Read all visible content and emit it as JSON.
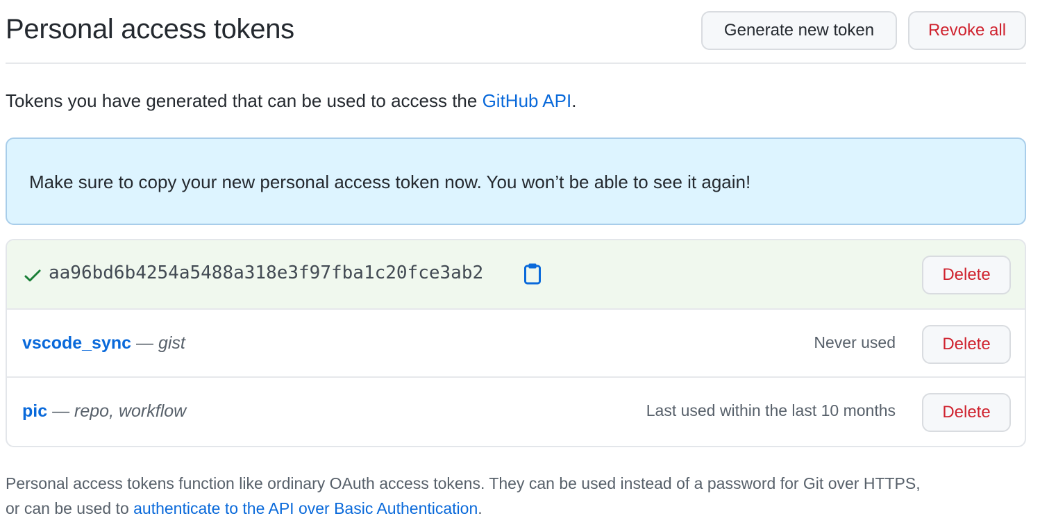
{
  "header": {
    "title": "Personal access tokens",
    "generate_label": "Generate new token",
    "revoke_label": "Revoke all"
  },
  "intro": {
    "text": "Tokens you have generated that can be used to access the ",
    "link": "GitHub API",
    "suffix": "."
  },
  "flash": {
    "message": "Make sure to copy your new personal access token now. You won’t be able to see it again!"
  },
  "new_token": {
    "value": "aa96bd6b4254a5488a318e3f97fba1c20fce3ab2",
    "delete_label": "Delete",
    "check_color": "#1a7f37",
    "copy_icon": "clipboard-icon"
  },
  "tokens": [
    {
      "name": "vscode_sync",
      "separator": " — ",
      "scopes": "gist",
      "last_used": "Never used",
      "delete_label": "Delete"
    },
    {
      "name": "pic",
      "separator": " — ",
      "scopes": "repo, workflow",
      "last_used": "Last used within the last 10 months",
      "delete_label": "Delete"
    }
  ],
  "footnote": {
    "line1": "Personal access tokens function like ordinary OAuth access tokens. They can be used instead of a password for Git over HTTPS,",
    "line2_prefix": "or can be used to ",
    "line2_link": "authenticate to the API over Basic Authentication",
    "line2_suffix": "."
  },
  "colors": {
    "link": "#0969da",
    "danger": "#cf222e",
    "flash_bg": "#ddf4ff",
    "success_bg": "#f0f8ee"
  }
}
